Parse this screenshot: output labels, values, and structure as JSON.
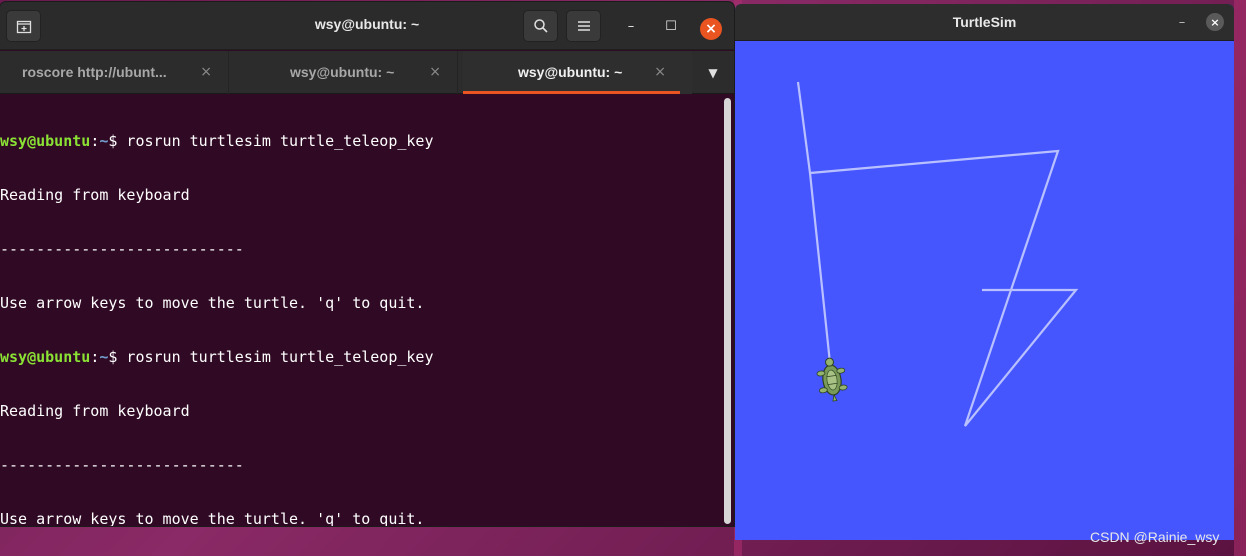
{
  "terminal": {
    "title": "wsy@ubuntu: ~",
    "tabs": [
      {
        "label": "roscore http://ubunt...",
        "active": false
      },
      {
        "label": "wsy@ubuntu: ~",
        "active": false
      },
      {
        "label": "wsy@ubuntu: ~",
        "active": true
      }
    ],
    "tab_close_glyph": "×",
    "tab_menu_glyph": "▼",
    "buttons": {
      "new_tab_icon": "new-tab-icon",
      "search_icon": "search-icon",
      "menu_icon": "hamburger-menu-icon",
      "minimize_glyph": "–",
      "maximize_glyph": "☐",
      "close_glyph": "×"
    },
    "lines": [
      {
        "user": "wsy@ubuntu",
        "sep": ":",
        "path": "~",
        "cmd": "$ rosrun turtlesim turtle_teleop_key"
      },
      {
        "text": "Reading from keyboard"
      },
      {
        "text": "---------------------------"
      },
      {
        "text": "Use arrow keys to move the turtle. 'q' to quit."
      },
      {
        "user": "wsy@ubuntu",
        "sep": ":",
        "path": "~",
        "cmd": "$ rosrun turtlesim turtle_teleop_key"
      },
      {
        "text": "Reading from keyboard"
      },
      {
        "text": "---------------------------"
      },
      {
        "text": "Use arrow keys to move the turtle. 'q' to quit."
      }
    ],
    "colors": {
      "background": "#300a24",
      "prompt_user": "#8ae234",
      "prompt_path": "#729fcf",
      "accent": "#e95420"
    }
  },
  "turtlesim": {
    "title": "TurtleSim",
    "minimize_glyph": "–",
    "close_glyph": "×",
    "background_color": "#4556ff",
    "path_color": "#b9c0ff"
  },
  "watermark": "CSDN @Rainie_wsy"
}
